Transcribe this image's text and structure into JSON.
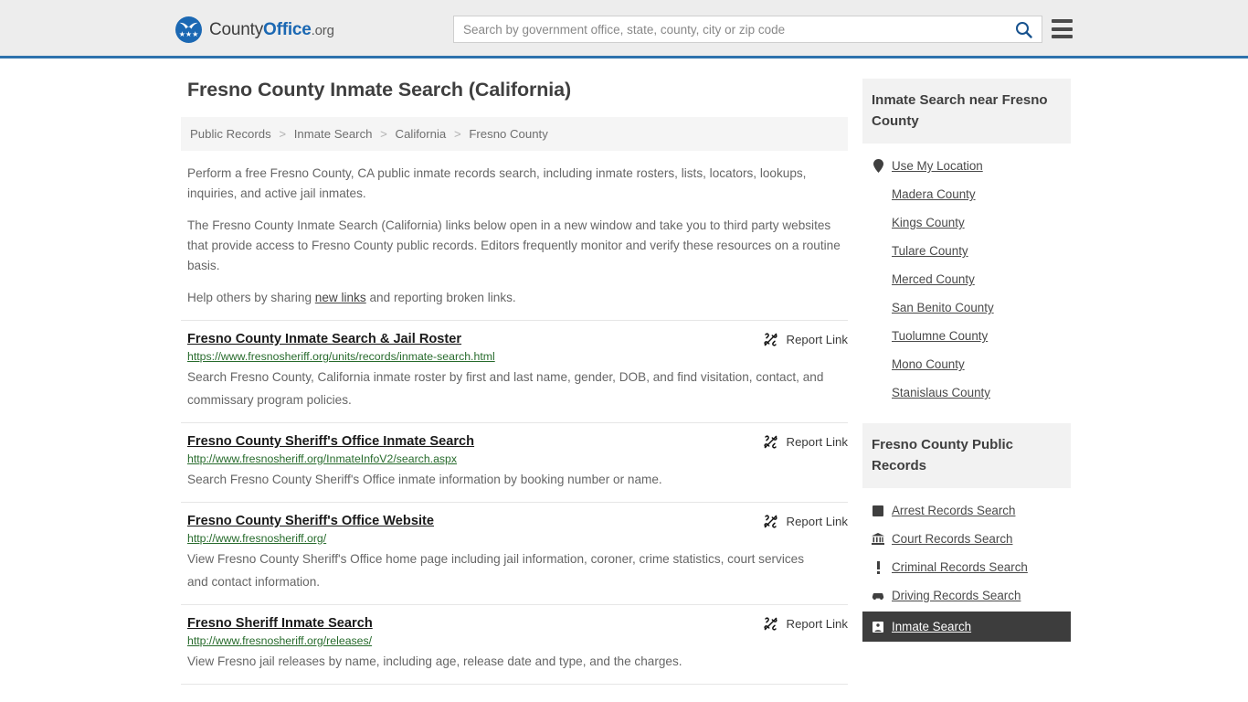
{
  "header": {
    "brand": {
      "part1": "County",
      "part2": "Office",
      "part3": ".org",
      "logo_icon": "eagle-shield-icon"
    },
    "search": {
      "placeholder": "Search by government office, state, county, city or zip code",
      "value": "",
      "search_icon": "search-icon"
    },
    "menu_icon": "hamburger-menu-icon",
    "accent_color": "#2e72ad",
    "background_color": "#ededed"
  },
  "page_title": "Fresno County Inmate Search (California)",
  "breadcrumb": {
    "items": [
      {
        "label": "Public Records"
      },
      {
        "label": "Inmate Search"
      },
      {
        "label": "California"
      },
      {
        "label": "Fresno County"
      }
    ],
    "separator": ">"
  },
  "intro": {
    "p1": "Perform a free Fresno County, CA public inmate records search, including inmate rosters, lists, locators, lookups, inquiries, and active jail inmates.",
    "p2": "The Fresno County Inmate Search (California) links below open in a new window and take you to third party websites that provide access to Fresno County public records. Editors frequently monitor and verify these resources on a routine basis.",
    "p3_before": "Help others by sharing ",
    "p3_link": "new links",
    "p3_after": " and reporting broken links."
  },
  "results": [
    {
      "title": "Fresno County Inmate Search & Jail Roster",
      "url": "https://www.fresnosheriff.org/units/records/inmate-search.html",
      "description": "Search Fresno County, California inmate roster by first and last name, gender, DOB, and find visitation, contact, and commissary program policies.",
      "report_label": "Report Link",
      "report_icon": "broken-link-icon"
    },
    {
      "title": "Fresno County Sheriff's Office Inmate Search",
      "url": "http://www.fresnosheriff.org/InmateInfoV2/search.aspx",
      "description": "Search Fresno County Sheriff's Office inmate information by booking number or name.",
      "report_label": "Report Link",
      "report_icon": "broken-link-icon"
    },
    {
      "title": "Fresno County Sheriff's Office Website",
      "url": "http://www.fresnosheriff.org/",
      "description": "View Fresno County Sheriff's Office home page including jail information, coroner, crime statistics, court services and contact information.",
      "report_label": "Report Link",
      "report_icon": "broken-link-icon"
    },
    {
      "title": "Fresno Sheriff Inmate Search",
      "url": "http://www.fresnosheriff.org/releases/",
      "description": "View Fresno jail releases by name, including age, release date and type, and the charges.",
      "report_label": "Report Link",
      "report_icon": "broken-link-icon"
    }
  ],
  "sidebar": {
    "nearby": {
      "heading": "Inmate Search near Fresno County",
      "items": [
        {
          "label": "Use My Location",
          "icon": "map-pin-icon"
        },
        {
          "label": "Madera County",
          "icon": ""
        },
        {
          "label": "Kings County",
          "icon": ""
        },
        {
          "label": "Tulare County",
          "icon": ""
        },
        {
          "label": "Merced County",
          "icon": ""
        },
        {
          "label": "San Benito County",
          "icon": ""
        },
        {
          "label": "Tuolumne County",
          "icon": ""
        },
        {
          "label": "Mono County",
          "icon": ""
        },
        {
          "label": "Stanislaus County",
          "icon": ""
        }
      ]
    },
    "public_records": {
      "heading": "Fresno County Public Records",
      "items": [
        {
          "label": "Arrest Records Search",
          "icon": "handcuffs-square-icon",
          "active": false
        },
        {
          "label": "Court Records Search",
          "icon": "courthouse-icon",
          "active": false
        },
        {
          "label": "Criminal Records Search",
          "icon": "exclamation-icon",
          "active": false
        },
        {
          "label": "Driving Records Search",
          "icon": "car-icon",
          "active": false
        },
        {
          "label": "Inmate Search",
          "icon": "inmate-icon",
          "active": true
        }
      ],
      "active_background": "#3d3d3d"
    }
  }
}
